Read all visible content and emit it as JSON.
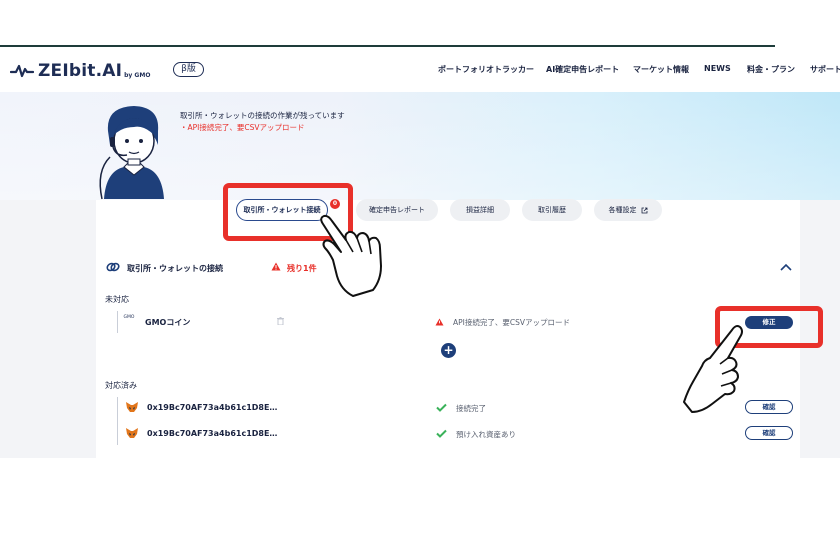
{
  "header": {
    "logo_text": "ZEIbit.AI",
    "logo_by": "by GMO",
    "beta_label": "β版",
    "nav": [
      "ポートフォリオトラッカー",
      "AI確定申告レポート",
      "マーケット情報",
      "NEWS",
      "料金・プラン",
      "サポート"
    ]
  },
  "hero": {
    "message": "取引所・ウォレットの接続の作業が残っています",
    "alert": "・API接続完了、要CSVアップロード"
  },
  "tabs": [
    {
      "label": "取引所・ウォレット接続",
      "active": true,
      "badge": "0"
    },
    {
      "label": "確定申告レポート",
      "active": false
    },
    {
      "label": "損益詳細",
      "active": false
    },
    {
      "label": "取引履歴",
      "active": false
    },
    {
      "label": "各種設定",
      "active": false,
      "icon": "external-link-icon"
    }
  ],
  "panel": {
    "title": "取引所・ウォレットの接続",
    "remaining": "残り1件",
    "unhandled_label": "未対応",
    "handled_label": "対応済み",
    "unhandled": [
      {
        "logo": "GMO",
        "name": "GMOコイン",
        "status": "API接続完了、要CSVアップロード",
        "button": "修正"
      }
    ],
    "handled": [
      {
        "name": "0x19Bc70AF73a4b61c1D8E…",
        "status": "接続完了",
        "button": "確認"
      },
      {
        "name": "0x19Bc70AF73a4b61c1D8E…",
        "status": "預け入れ資産あり",
        "button": "確認"
      }
    ]
  },
  "colors": {
    "accent": "#1e3f7a",
    "alert": "#e8302a",
    "highlight_box": "#e8302a"
  }
}
